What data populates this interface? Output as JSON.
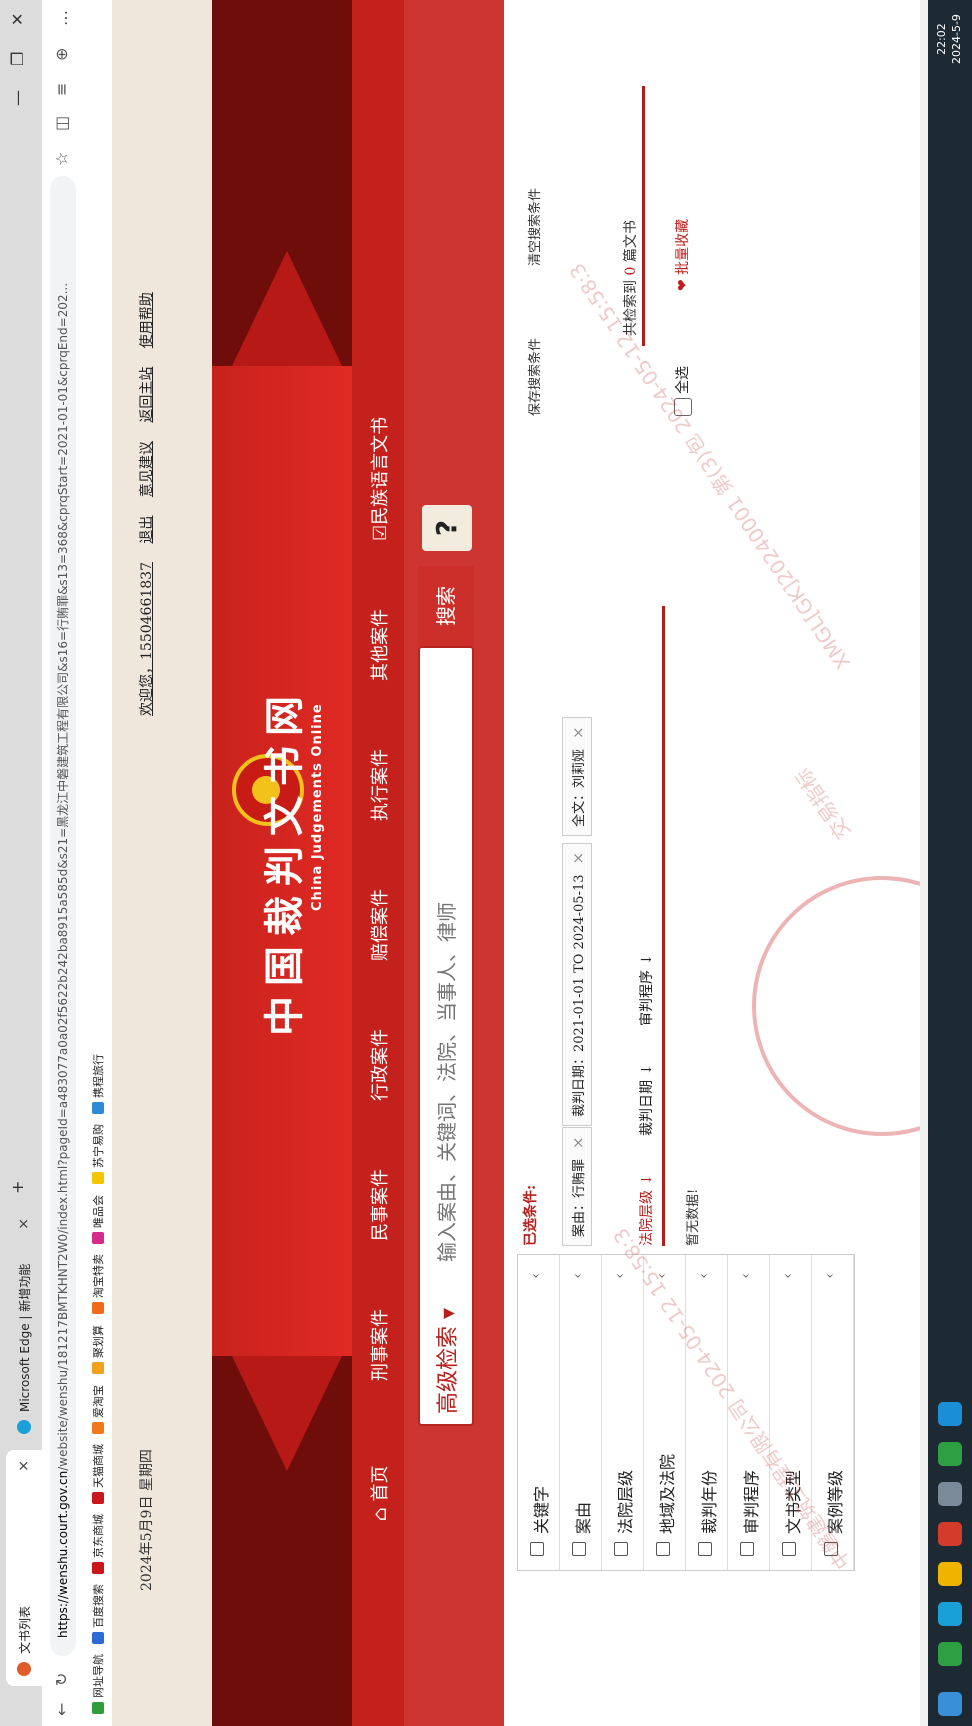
{
  "browser": {
    "tab1_title": "文书列表",
    "tab2_title": "Microsoft Edge | 新增功能",
    "new_tab": "+",
    "url_host": "https://wenshu.court.gov.cn",
    "url_path": "/website/wenshu/181217BMTKHNT2W0/index.html?pageId=a483077a0a02f5622b242ba8915a585d&s21=黑龙江中磐建筑工程有限公司&s16=行贿罪&s13=368&cprqStart=2021-01-01&cprqEnd=202...",
    "bookmarks": [
      "网址导航",
      "百度搜索",
      "京东商城",
      "天猫商城",
      "爱淘宝",
      "聚划算",
      "淘宝特卖",
      "唯品会",
      "苏宁易购",
      "携程旅行"
    ],
    "accent": "#0078d4"
  },
  "header": {
    "date": "2024年5月9日 星期四",
    "welcome": "欢迎您，15504661837",
    "logout": "退出",
    "feedback": "意见建议",
    "home_site": "返回主站",
    "help": "使用帮助"
  },
  "brand": {
    "title": "中国裁判文书网",
    "subtitle": "China Judgements Online",
    "color": "#c4211c"
  },
  "nav": {
    "items": [
      "首页",
      "刑事案件",
      "民事案件",
      "行政案件",
      "赔偿案件",
      "执行案件",
      "其他案件",
      "民族语言文书"
    ]
  },
  "search": {
    "advanced": "高级检索",
    "placeholder": "输入案由、关键词、法院、当事人、律师",
    "button": "搜索",
    "help": "?"
  },
  "filters": {
    "items": [
      "关键字",
      "案由",
      "法院层级",
      "地域及法院",
      "裁判年份",
      "审判程序",
      "文书类型",
      "案例等级"
    ]
  },
  "conditions": {
    "label": "已选条件:",
    "chips": [
      "案由：行贿罪",
      "裁判日期：2021-01-01 TO 2024-05-13",
      "全文：刘莉娅"
    ],
    "save": "保存搜索条件",
    "clear": "清空搜索条件"
  },
  "results": {
    "sort_court": "法院层级",
    "sort_date": "裁判日期",
    "sort_proc": "审判程序",
    "count_prefix": "共检索到",
    "count": "0",
    "count_suffix": "篇文书",
    "empty": "暂无数据!",
    "select_all": "全选",
    "batch_fav": "批量收藏"
  },
  "watermark": {
    "line1": "交易指标",
    "line2": "XMGL[GK]20240001 第(3)包 2024-05-12 15:58:3",
    "line3": "中磐建筑工程有限公司 2024-05-12 15:58:3"
  },
  "taskbar": {
    "time": "22:02",
    "date": "2024-5-9"
  }
}
